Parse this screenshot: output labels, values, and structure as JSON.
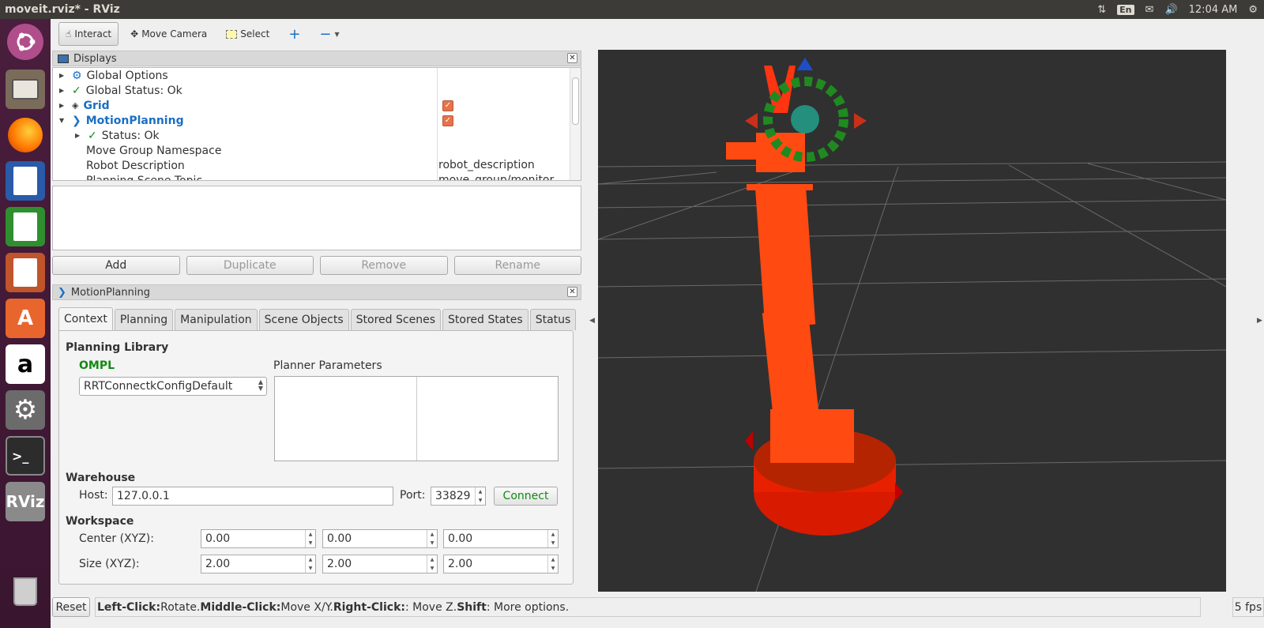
{
  "window": {
    "title": "moveit.rviz* - RViz"
  },
  "tray": {
    "lang": "En",
    "time": "12:04 AM"
  },
  "launcher": {
    "items": [
      "ubuntu-dash",
      "files",
      "firefox",
      "writer",
      "calc",
      "impress",
      "software-center",
      "amazon",
      "system-settings",
      "terminal",
      "rviz",
      "trash"
    ],
    "rviz_label": "RViz"
  },
  "toolbar": {
    "interact": "Interact",
    "move_camera": "Move Camera",
    "select": "Select"
  },
  "displays": {
    "title": "Displays",
    "rows": [
      {
        "label": "Global Options",
        "value": ""
      },
      {
        "label": "Global Status: Ok",
        "value": ""
      },
      {
        "label": "Grid",
        "value": ""
      },
      {
        "label": "MotionPlanning",
        "value": ""
      },
      {
        "label": "Status: Ok",
        "value": ""
      },
      {
        "label": "Move Group Namespace",
        "value": ""
      },
      {
        "label": "Robot Description",
        "value": "robot_description"
      },
      {
        "label": "Planning Scene Topic",
        "value": "move_group/monitor"
      }
    ],
    "buttons": {
      "add": "Add",
      "duplicate": "Duplicate",
      "remove": "Remove",
      "rename": "Rename"
    }
  },
  "motion": {
    "title": "MotionPlanning",
    "tabs": [
      "Context",
      "Planning",
      "Manipulation",
      "Scene Objects",
      "Stored Scenes",
      "Stored States",
      "Status"
    ],
    "planning_library": "Planning Library",
    "ompl": "OMPL",
    "planner": "RRTConnectkConfigDefault",
    "planner_params": "Planner Parameters",
    "warehouse": "Warehouse",
    "host_label": "Host:",
    "host": "127.0.0.1",
    "port_label": "Port:",
    "port": "33829",
    "connect": "Connect",
    "workspace": "Workspace",
    "center_label": "Center (XYZ):",
    "size_label": "Size (XYZ):",
    "center": [
      "0.00",
      "0.00",
      "0.00"
    ],
    "size": [
      "2.00",
      "2.00",
      "2.00"
    ]
  },
  "status": {
    "reset": "Reset",
    "h1": "Left-Click:",
    "t1": " Rotate. ",
    "h2": "Middle-Click:",
    "t2": " Move X/Y. ",
    "h3": "Right-Click:",
    "t3": ": Move Z. ",
    "h4": "Shift",
    "t4": ": More options.",
    "fps": "5 fps"
  },
  "colors": {
    "robot": "#ff4a12",
    "accent_blue": "#1a6fc4",
    "ok_green": "#138a13"
  }
}
